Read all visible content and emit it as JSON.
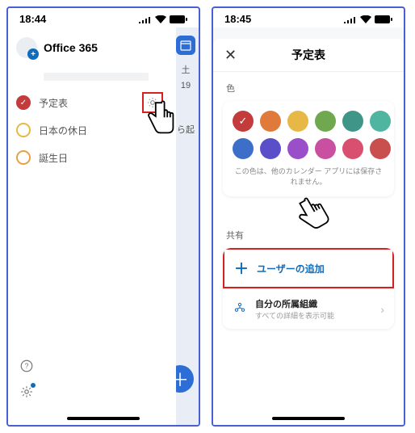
{
  "left": {
    "time": "18:44",
    "account_name": "Office 365",
    "calendars": [
      {
        "label": "予定表",
        "checked": true
      },
      {
        "label": "日本の休日",
        "checked": false
      },
      {
        "label": "誕生日",
        "checked": false
      }
    ],
    "behind_day": "土",
    "behind_date": "19",
    "behind_text": "ら起"
  },
  "right": {
    "time": "18:45",
    "title": "予定表",
    "colors_label": "色",
    "colors": [
      {
        "hex": "#c43b3b",
        "selected": true
      },
      {
        "hex": "#e07a3a",
        "selected": false
      },
      {
        "hex": "#e8b847",
        "selected": false
      },
      {
        "hex": "#6fa84f",
        "selected": false
      },
      {
        "hex": "#3f9688",
        "selected": false
      },
      {
        "hex": "#4fb5a0",
        "selected": false
      },
      {
        "hex": "#3d6fc9",
        "selected": false
      },
      {
        "hex": "#5a4fc9",
        "selected": false
      },
      {
        "hex": "#9a4fc9",
        "selected": false
      },
      {
        "hex": "#c94fa0",
        "selected": false
      },
      {
        "hex": "#d84f70",
        "selected": false
      },
      {
        "hex": "#c94f4f",
        "selected": false
      }
    ],
    "color_note": "この色は、他のカレンダー アプリには保存されません。",
    "share_label": "共有",
    "add_user_label": "ユーザーの追加",
    "org_title": "自分の所属組織",
    "org_sub": "すべての詳細を表示可能"
  }
}
